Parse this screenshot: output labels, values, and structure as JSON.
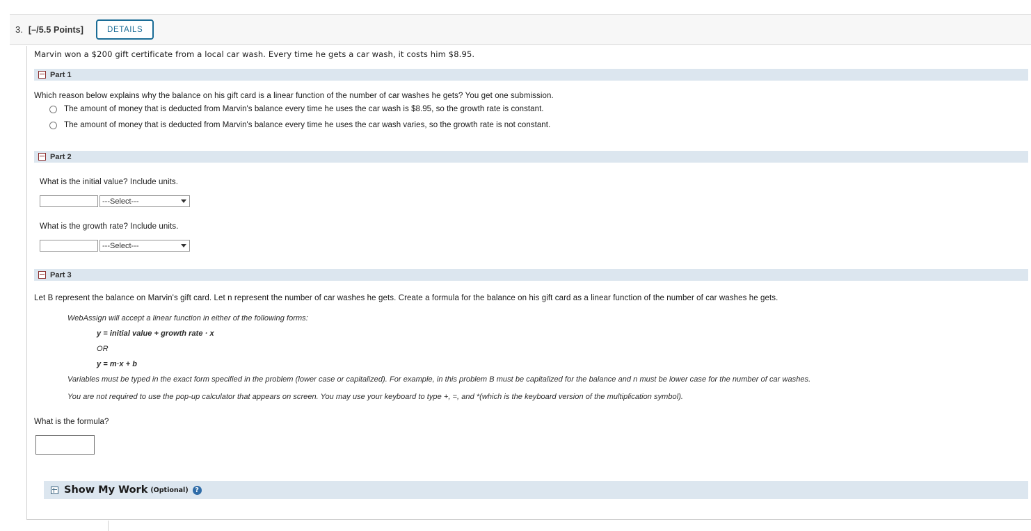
{
  "header": {
    "number": "3.",
    "points": "[–/5.5 Points]",
    "details_label": "DETAILS"
  },
  "prompt": "Marvin won a $200 gift certificate from a local car wash. Every time he gets a car wash, it costs him $8.95.",
  "parts": [
    {
      "label": "Part 1",
      "expander": "minus-icon",
      "question": "Which reason below explains why the balance on his gift card is a linear function of the number of car washes he gets? You get one submission.",
      "choices": [
        "The amount of money that is deducted from Marvin's balance every time he uses the car wash is $8.95, so the growth rate is constant.",
        "The amount of money that is deducted from Marvin's balance every time he uses the car wash varies, so the growth rate is not constant."
      ]
    },
    {
      "label": "Part 2",
      "expander": "minus-icon",
      "fields": [
        {
          "question": "What is the initial value? Include units.",
          "value": "",
          "placeholder": "",
          "select_value": "---Select---"
        },
        {
          "question": "What is the growth rate? Include units.",
          "value": "",
          "placeholder": "",
          "select_value": "---Select---"
        }
      ]
    },
    {
      "label": "Part 3",
      "expander": "minus-icon",
      "question": "Let B represent the balance on Marvin's gift card. Let n represent the number of car washes he gets. Create a formula for the balance on his gift card as a linear function of the number of car washes he gets.",
      "help": {
        "intro": "WebAssign will accept a linear function in either of the following forms:",
        "form1": "y = initial value + growth rate · x",
        "or": "OR",
        "form2": "y = m·x + b",
        "variables_note": "Variables must be typed in the exact form specified in the problem (lower case or capitalized). For example, in this problem B must be capitalized for the balance and n must be lower case for the number of car washes.",
        "calculator_note": "You are not required to use the pop-up calculator that appears on screen. You may use your keyboard to type +, =, and *(which is the keyboard version of the multiplication symbol)."
      },
      "formula_question": "What is the formula?",
      "formula_value": "",
      "formula_placeholder": ""
    }
  ],
  "show_my_work": {
    "expander": "plus-icon",
    "title": "Show My Work",
    "optional": "(Optional)",
    "help_icon": "?"
  },
  "colors": {
    "part_bar": "#dce6ef",
    "details_border": "#1a6c96",
    "header_bg": "#f7f7f7",
    "help_icon_bg": "#2f6ca8",
    "expander_red": "#8b2b2b"
  }
}
